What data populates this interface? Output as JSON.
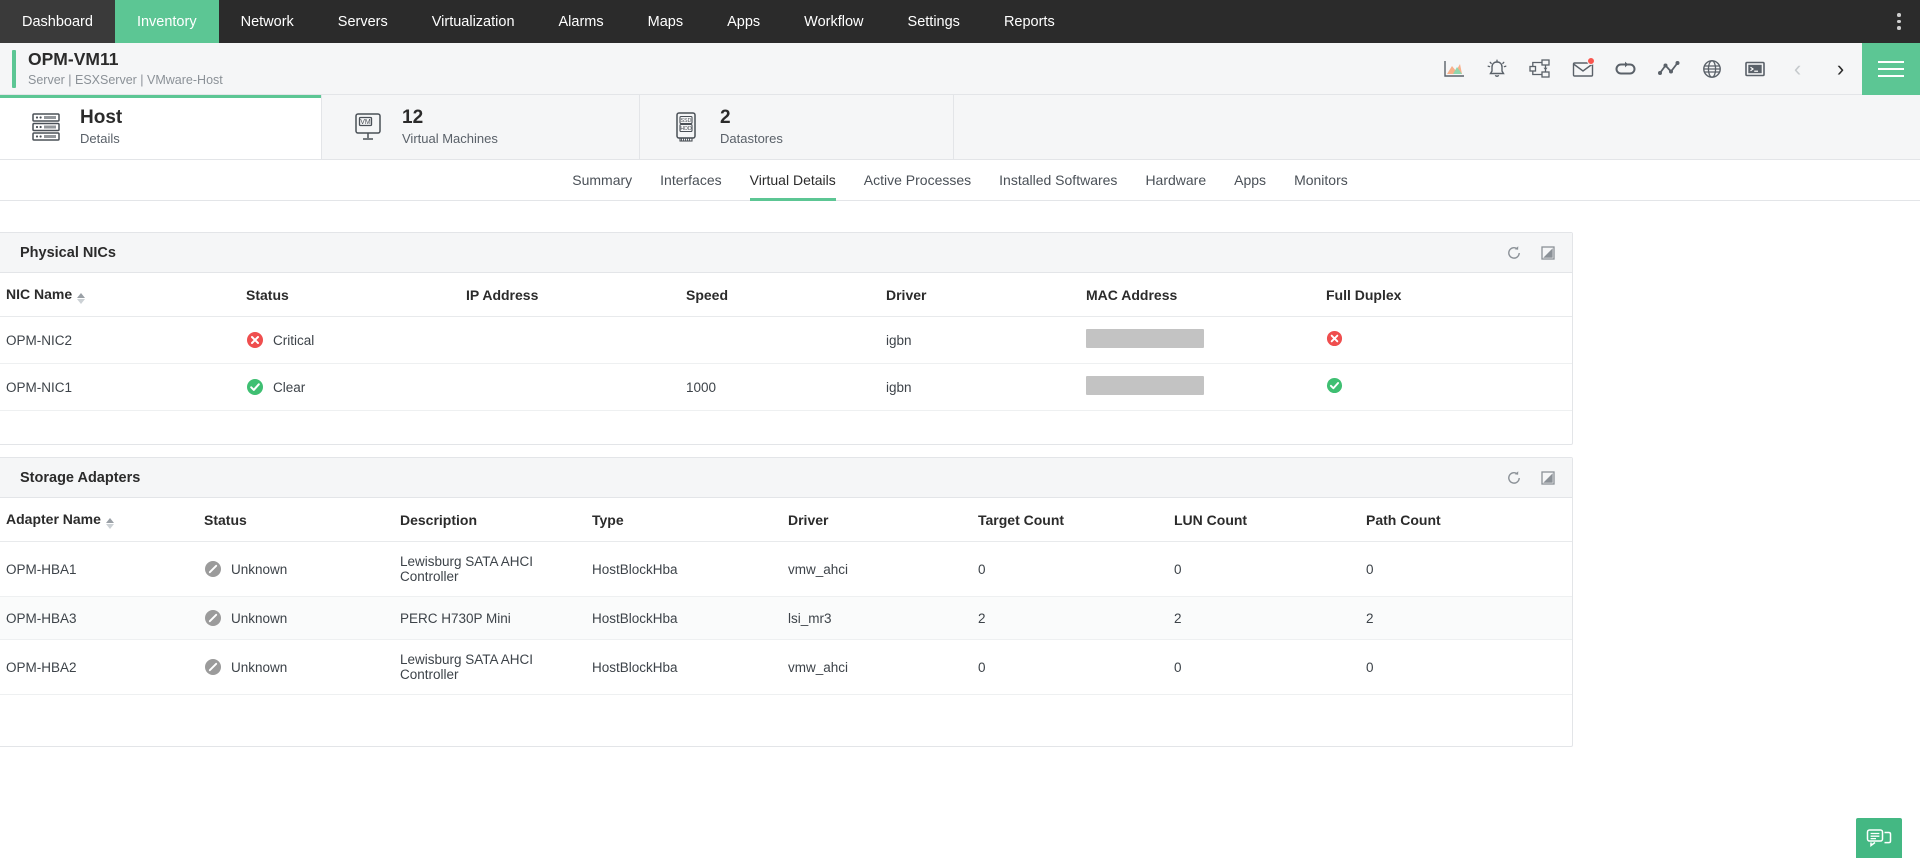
{
  "theme": {
    "nav_bg": "#2b2b2b",
    "accent_green": "#5cc694",
    "accent_red": "#f9564f",
    "critical": "#ef4e4e",
    "clear": "#3fbf72",
    "unknown": "#9b9b9b"
  },
  "nav": {
    "items": [
      {
        "label": "Dashboard",
        "active": false
      },
      {
        "label": "Inventory",
        "active": true
      },
      {
        "label": "Network",
        "active": false
      },
      {
        "label": "Servers",
        "active": false
      },
      {
        "label": "Virtualization",
        "active": false
      },
      {
        "label": "Alarms",
        "active": false
      },
      {
        "label": "Maps",
        "active": false
      },
      {
        "label": "Apps",
        "active": false
      },
      {
        "label": "Workflow",
        "active": false
      },
      {
        "label": "Settings",
        "active": false
      },
      {
        "label": "Reports",
        "active": false
      }
    ],
    "kebab": "more-options"
  },
  "device": {
    "name": "OPM-VM11",
    "meta": "Server | ESXServer | VMware-Host",
    "tools": [
      {
        "icon": "area-chart-icon"
      },
      {
        "icon": "alarm-bell-icon"
      },
      {
        "icon": "workflow-icon"
      },
      {
        "icon": "mail-icon",
        "badge": true
      },
      {
        "icon": "loop-icon"
      },
      {
        "icon": "line-graph-icon"
      },
      {
        "icon": "globe-icon"
      },
      {
        "icon": "terminal-icon"
      }
    ],
    "prev_label": "‹",
    "next_label": "›",
    "menu_label": "menu"
  },
  "cards": [
    {
      "icon": "server-rack-icon",
      "primary": "Host",
      "secondary": "Details",
      "active": true
    },
    {
      "icon": "vm-monitor-icon",
      "primary": "12",
      "secondary": "Virtual Machines",
      "active": false
    },
    {
      "icon": "ssd-hdd-icon",
      "primary": "2",
      "secondary": "Datastores",
      "active": false
    }
  ],
  "tabs": [
    {
      "label": "Summary",
      "active": false
    },
    {
      "label": "Interfaces",
      "active": false
    },
    {
      "label": "Virtual Details",
      "active": true
    },
    {
      "label": "Active Processes",
      "active": false
    },
    {
      "label": "Installed Softwares",
      "active": false
    },
    {
      "label": "Hardware",
      "active": false
    },
    {
      "label": "Apps",
      "active": false
    },
    {
      "label": "Monitors",
      "active": false
    }
  ],
  "physical_nics": {
    "title": "Physical NICs",
    "actions": [
      {
        "icon": "refresh-icon"
      },
      {
        "icon": "resize-icon"
      }
    ],
    "columns": [
      "NIC Name",
      "Status",
      "IP Address",
      "Speed",
      "Driver",
      "MAC Address",
      "Full Duplex"
    ],
    "sorted_column": "NIC Name",
    "rows": [
      {
        "nic_name": "OPM-NIC2",
        "status": "Critical",
        "status_kind": "critical",
        "ip_address": "",
        "speed": "",
        "driver": "igbn",
        "mac_address": "",
        "mac_redacted": true,
        "full_duplex": "false"
      },
      {
        "nic_name": "OPM-NIC1",
        "status": "Clear",
        "status_kind": "clear",
        "ip_address": "",
        "speed": "1000",
        "driver": "igbn",
        "mac_address": "",
        "mac_redacted": true,
        "full_duplex": "true"
      }
    ]
  },
  "storage_adapters": {
    "title": "Storage Adapters",
    "actions": [
      {
        "icon": "refresh-icon"
      },
      {
        "icon": "resize-icon"
      }
    ],
    "columns": [
      "Adapter Name",
      "Status",
      "Description",
      "Type",
      "Driver",
      "Target Count",
      "LUN Count",
      "Path Count"
    ],
    "sorted_column": "Adapter Name",
    "rows": [
      {
        "adapter_name": "OPM-HBA1",
        "status": "Unknown",
        "status_kind": "unknown",
        "description": "Lewisburg SATA AHCI Controller",
        "type": "HostBlockHba",
        "driver": "vmw_ahci",
        "target_count": "0",
        "lun_count": "0",
        "path_count": "0"
      },
      {
        "adapter_name": "OPM-HBA3",
        "status": "Unknown",
        "status_kind": "unknown",
        "description": "PERC H730P Mini",
        "type": "HostBlockHba",
        "driver": "lsi_mr3",
        "target_count": "2",
        "lun_count": "2",
        "path_count": "2"
      },
      {
        "adapter_name": "OPM-HBA2",
        "status": "Unknown",
        "status_kind": "unknown",
        "description": "Lewisburg SATA AHCI Controller",
        "type": "HostBlockHba",
        "driver": "vmw_ahci",
        "target_count": "0",
        "lun_count": "0",
        "path_count": "0"
      }
    ]
  },
  "chat": {
    "icon": "chat-bubbles-icon"
  }
}
